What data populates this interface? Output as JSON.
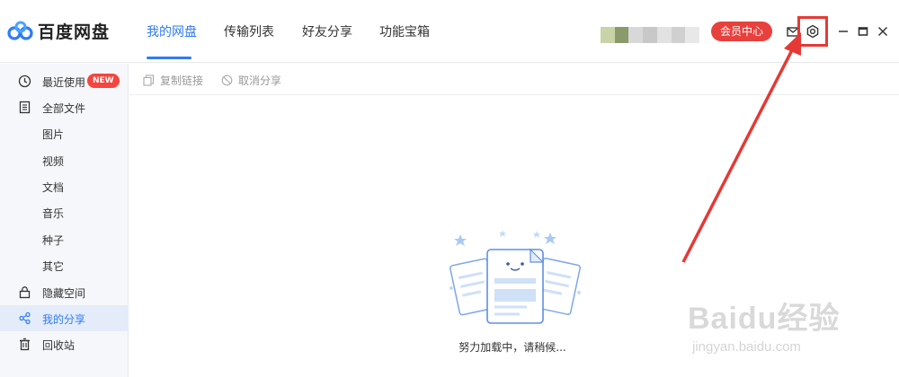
{
  "app": {
    "name": "百度网盘"
  },
  "nav": {
    "tabs": [
      {
        "label": "我的网盘",
        "active": true
      },
      {
        "label": "传输列表",
        "active": false
      },
      {
        "label": "好友分享",
        "active": false
      },
      {
        "label": "功能宝箱",
        "active": false
      }
    ]
  },
  "header": {
    "vip_label": "会员中心",
    "icons": [
      "mail-icon",
      "settings-icon",
      "minimize-icon",
      "maximize-icon",
      "close-icon"
    ],
    "accent_color": "#2f7bf5",
    "vip_color": "#e8413d"
  },
  "sidebar": {
    "items": [
      {
        "label": "最近使用",
        "icon": "clock-icon",
        "badge": "NEW"
      },
      {
        "label": "全部文件",
        "icon": "document-icon"
      },
      {
        "label": "图片"
      },
      {
        "label": "视频"
      },
      {
        "label": "文档"
      },
      {
        "label": "音乐"
      },
      {
        "label": "种子"
      },
      {
        "label": "其它"
      },
      {
        "label": "隐藏空间",
        "icon": "lock-icon"
      },
      {
        "label": "我的分享",
        "icon": "share-icon",
        "active": true
      },
      {
        "label": "回收站",
        "icon": "trash-icon"
      }
    ]
  },
  "toolbar": {
    "copy_link": "复制链接",
    "cancel_share": "取消分享"
  },
  "main": {
    "loading_text": "努力加载中，请稍候..."
  },
  "watermark": {
    "line1": "Baidu经验",
    "line2": "jingyan.baidu.com"
  }
}
